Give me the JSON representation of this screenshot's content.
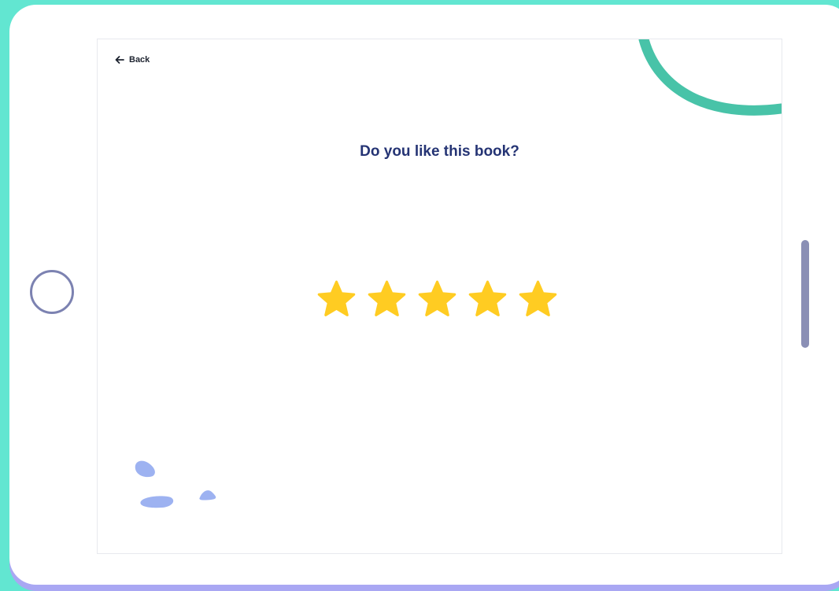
{
  "screen": {
    "back_label": "Back",
    "question": "Do you like this book?"
  },
  "rating": {
    "max_stars": 5,
    "selected": 5,
    "star_color": "#ffcc22"
  },
  "colors": {
    "background": "#62e6d1",
    "accent_arc": "#48c3a8",
    "title": "#253474",
    "decor_blobs": "#9db2f1"
  },
  "icons": {
    "back": "arrow-left-icon",
    "star": "star-icon"
  }
}
